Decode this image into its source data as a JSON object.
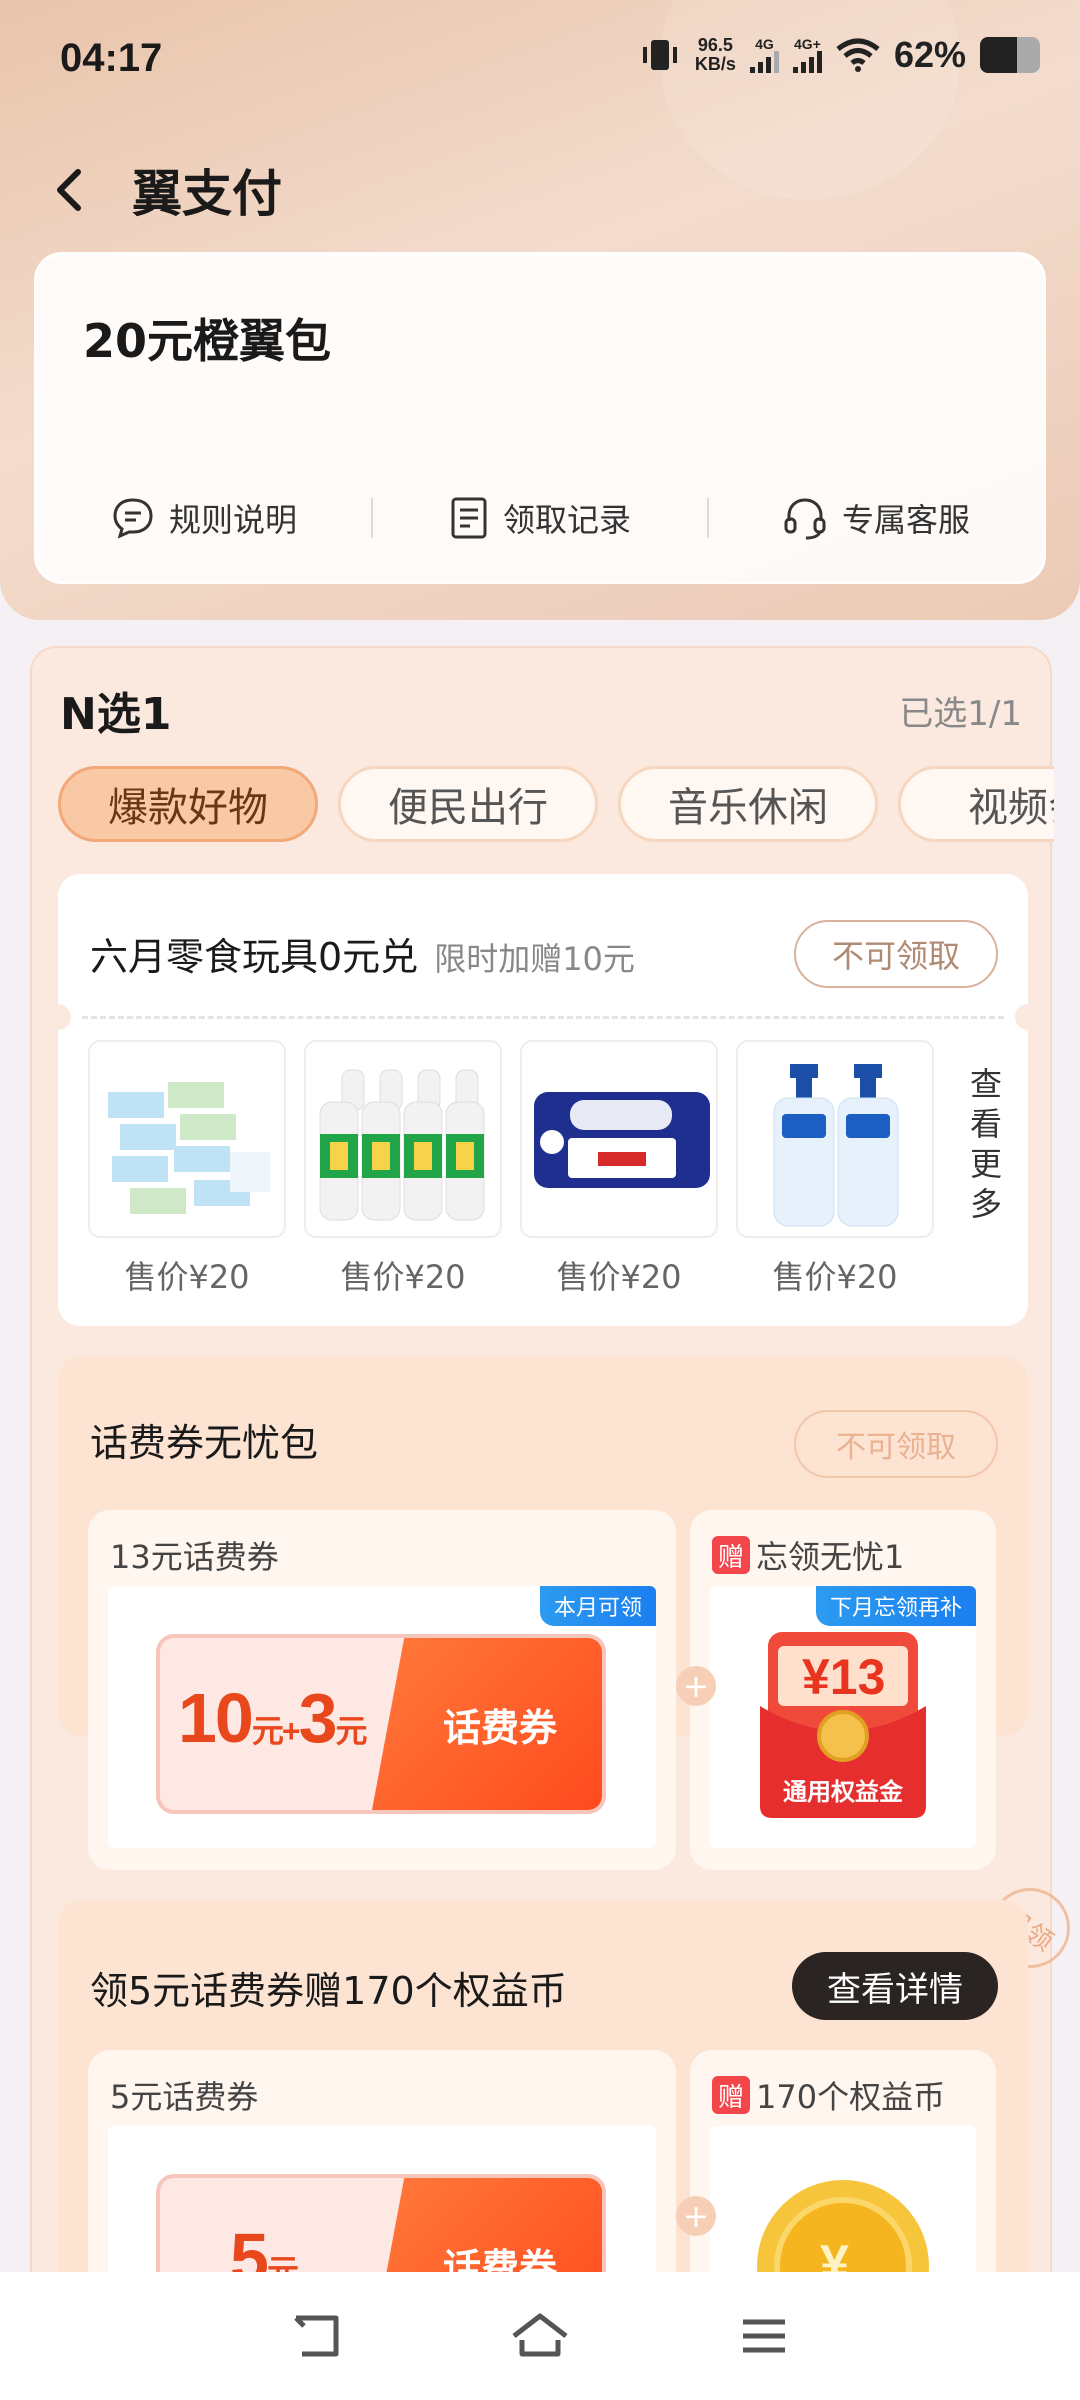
{
  "status_bar": {
    "time": "04:17",
    "net_speed_value": "96.5",
    "net_speed_unit": "KB/s",
    "sim1_label": "4G",
    "sim2_label": "4G+",
    "battery_percent": "62%",
    "battery_level": 0.62,
    "icons": [
      "vibrate-icon",
      "signal-icon",
      "signal-icon",
      "wifi-icon",
      "battery-icon"
    ]
  },
  "nav": {
    "title": "翼支付",
    "back_icon": "chevron-left-icon"
  },
  "hero": {
    "title": "20元橙翼包",
    "links": [
      {
        "label": "规则说明",
        "icon": "chat-bubble-icon"
      },
      {
        "label": "领取记录",
        "icon": "document-icon"
      },
      {
        "label": "专属客服",
        "icon": "headset-icon"
      }
    ]
  },
  "panel": {
    "title": "N选1",
    "status": "已选1/1",
    "tabs": [
      "爆款好物",
      "便民出行",
      "音乐休闲",
      "视频会"
    ],
    "active_tab_index": 0,
    "card1": {
      "title": "六月零食玩具0元兑",
      "subtitle": "限时加赠10元",
      "button": "不可领取",
      "products": [
        {
          "price": "售价¥20"
        },
        {
          "price": "售价¥20"
        },
        {
          "price": "售价¥20"
        },
        {
          "price": "售价¥20"
        }
      ],
      "more": [
        "查",
        "看",
        "更",
        "多"
      ]
    },
    "section1": {
      "title": "话费券无忧包",
      "button": "不可领取",
      "left_label": "13元话费券",
      "left_tag": "本月可领",
      "coupon_a": "10",
      "coupon_a_unit": "元",
      "coupon_plus": "+",
      "coupon_b": "3",
      "coupon_b_unit": "元",
      "coupon_type": "话费券",
      "gift_badge": "赠",
      "right_label": "忘领无忧1",
      "right_tag": "下月忘领再补",
      "red_amount": "¥13",
      "red_caption": "通用权益金",
      "plus_symbol": "+"
    },
    "stamp": "已领",
    "section2": {
      "title": "领5元话费券赠170个权益币",
      "button": "查看详情",
      "left_label": "5元话费券",
      "coupon_a": "5",
      "coupon_a_unit": "元",
      "coupon_type": "话费券",
      "gift_badge": "赠",
      "right_label": "170个权益币",
      "coin_symbol": "¥",
      "plus_symbol": "+"
    }
  },
  "bottom_nav": {
    "icons": [
      "back-nav-icon",
      "home-icon",
      "menu-icon"
    ]
  }
}
